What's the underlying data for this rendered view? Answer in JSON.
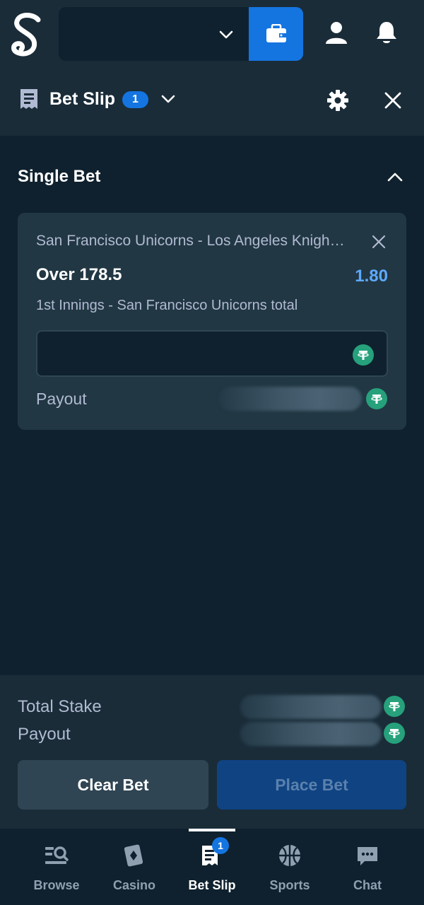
{
  "header": {
    "brand": "S"
  },
  "slip": {
    "title": "Bet Slip",
    "count": "1"
  },
  "section": {
    "title": "Single Bet"
  },
  "bet": {
    "match": "San Francisco Unicorns - Los Angeles Knight Riders",
    "selection": "Over 178.5",
    "odds": "1.80",
    "market": "1st Innings - San Francisco Unicorns total",
    "stake_value": "",
    "payout_label": "Payout"
  },
  "summary": {
    "total_stake_label": "Total Stake",
    "payout_label": "Payout",
    "clear_label": "Clear Bet",
    "place_label": "Place Bet"
  },
  "nav": {
    "items": [
      {
        "label": "Browse"
      },
      {
        "label": "Casino"
      },
      {
        "label": "Bet Slip",
        "badge": "1"
      },
      {
        "label": "Sports"
      },
      {
        "label": "Chat"
      }
    ]
  },
  "colors": {
    "background": "#0f212e",
    "panel": "#1a2c38",
    "card": "#213743",
    "accent_blue": "#1475e1",
    "odds_blue": "#5ea9ff",
    "tether_green": "#26a17b"
  },
  "icons": {
    "wallet": "wallet-icon",
    "user": "user-icon",
    "bell": "bell-icon",
    "slip": "receipt-icon",
    "settings": "gear-icon",
    "close": "close-icon",
    "currency": "tether-icon"
  }
}
